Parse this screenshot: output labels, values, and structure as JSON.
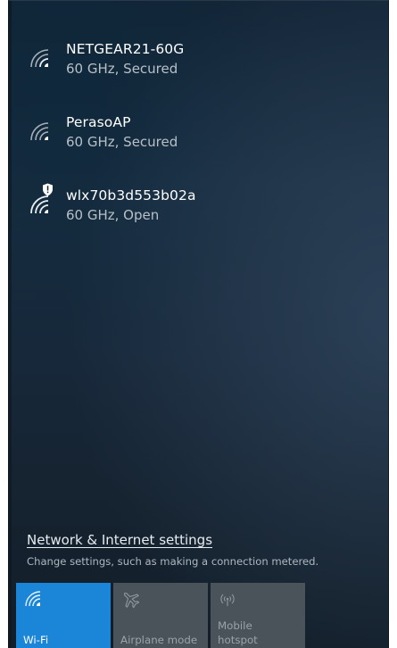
{
  "networks": [
    {
      "name": "NETGEAR21-60G",
      "status": "60 GHz, Secured",
      "icon": "wifi-signal-icon",
      "open": false
    },
    {
      "name": "PerasoAP",
      "status": "60 GHz, Secured",
      "icon": "wifi-signal-icon",
      "open": false
    },
    {
      "name": "wlx70b3d553b02a",
      "status": "60 GHz, Open",
      "icon": "wifi-signal-icon",
      "open": true,
      "badge_icon": "shield-warning-icon"
    }
  ],
  "settings": {
    "link_label": "Network & Internet settings",
    "description": "Change settings, such as making a connection metered."
  },
  "quick_actions": [
    {
      "label": "Wi-Fi",
      "icon": "wifi-icon",
      "active": true
    },
    {
      "label": "Airplane mode",
      "icon": "airplane-icon",
      "active": false
    },
    {
      "label_line1": "Mobile",
      "label_line2": "hotspot",
      "icon": "hotspot-icon",
      "active": false
    }
  ],
  "colors": {
    "accent": "#1b86d8",
    "tile_inactive": "#4a525a",
    "panel_bg": "#172a3c",
    "text_primary": "#ffffff",
    "text_secondary": "#b7c0c9"
  }
}
